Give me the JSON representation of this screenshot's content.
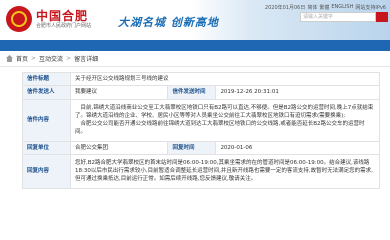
{
  "header": {
    "logo_title": "中国合肥",
    "logo_subtitle": "合肥市人民政府门户网站",
    "slogan": "大湖名城 创新高地",
    "top_links": [
      "2020年01月06日",
      "简体",
      "繁體",
      "ENGLISH",
      "网站支持IPv6"
    ],
    "search_placeholder": "请输入关键字"
  },
  "breadcrumb": [
    "首页",
    "互动交流",
    "留言详细"
  ],
  "message": {
    "title_label": "信件标题",
    "title": "关于经开区公交线路规划三号线的建议",
    "sender_label": "信件发送人",
    "sender": "我要建议",
    "send_time_label": "信件发送时间",
    "send_time": "2019-12-26 20:31:01",
    "content_label": "信件内容",
    "content_p1": "目前,锦绣大道沿线商业公交至工大翡翠校区地铁口只有B2路可以直达,不够便。但是B2路公交的运营时间,晚上7点就结束了。锦绣大道沿线的企业、学校、居民小区等等对人员乘坐公交前往工大翡翠校区地铁口有迫切需求(需要换乘);",
    "content_p2": "合肥公交公司能否开通公交线路前往锦绣大道到达工大翡翠校区地铁口的公交线路,或者能否延长B2路公交车的运营时间。",
    "reply_unit_label": "回复单位",
    "reply_unit": "合肥公交集团",
    "reply_time_label": "回复时间",
    "reply_time": "2020-01-06",
    "reply_content_label": "回复内容",
    "reply_content": "您好,B2路合肥大学翡翠校区的首末站时间是06:00-19:00,其乘坐需求的在的管道时间是06:00-19:00。结合建议,该线路18:30以后市民出行需求较小,目前暂适合调整延长运营时间,并且新开线路也需要一定的客流支持,故暂时无法满足您的需求,但可通过换乘抵达,目前运行正常。如需后续开线路,您反馈建议,敬请关注。"
  }
}
